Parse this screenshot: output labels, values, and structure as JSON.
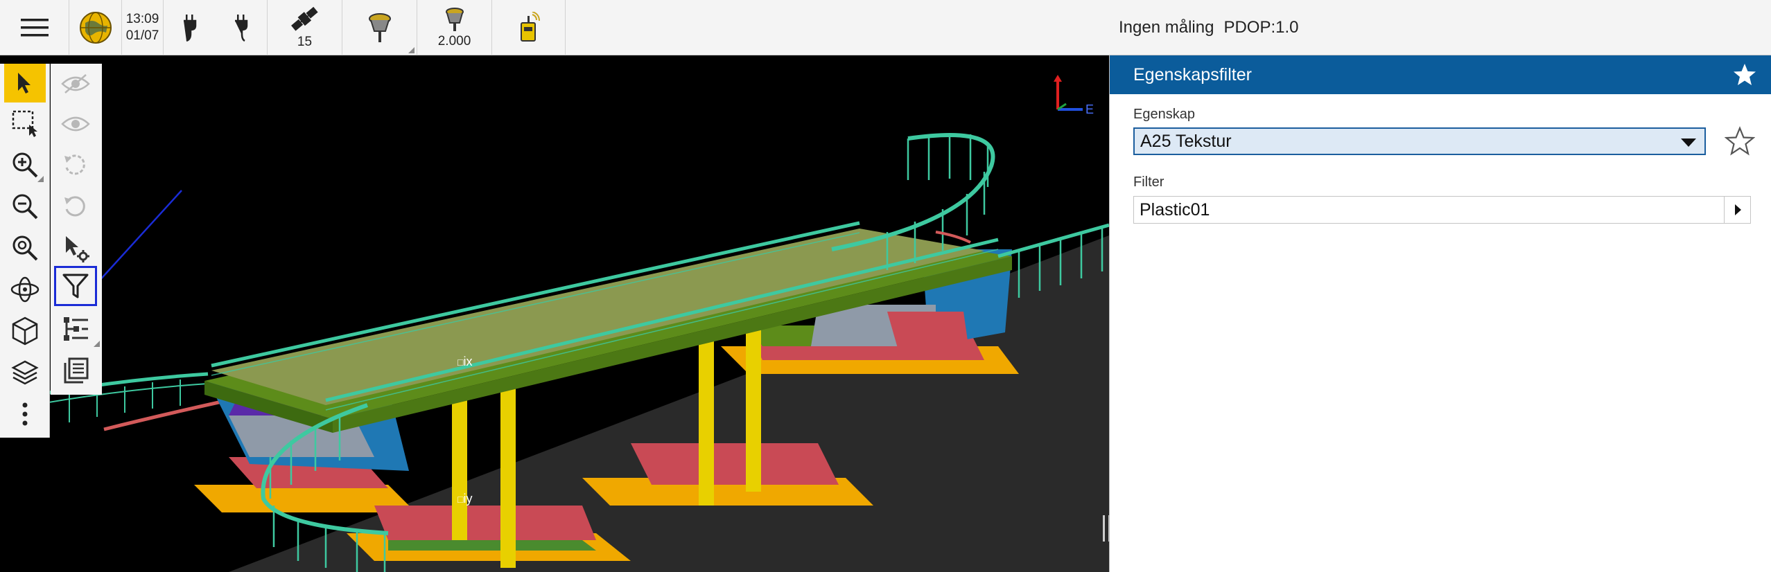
{
  "statusbar": {
    "time": "13:09",
    "date": "01/07",
    "satellites": "15",
    "antenna_height": "2.000"
  },
  "header": {
    "measure_status": "Ingen måling",
    "pdop": "PDOP:1.0"
  },
  "panel": {
    "title": "Egenskapsfilter",
    "property_label": "Egenskap",
    "property_value": "A25 Tekstur",
    "filter_label": "Filter",
    "filter_value": "Plastic01"
  },
  "viewport": {
    "axis_label": "E",
    "label_x": "ix",
    "label_y": "iy"
  },
  "colors": {
    "accent_blue": "#0b5c9b",
    "active_tool": "#f5c300",
    "highlight": "#1a2cd6"
  }
}
